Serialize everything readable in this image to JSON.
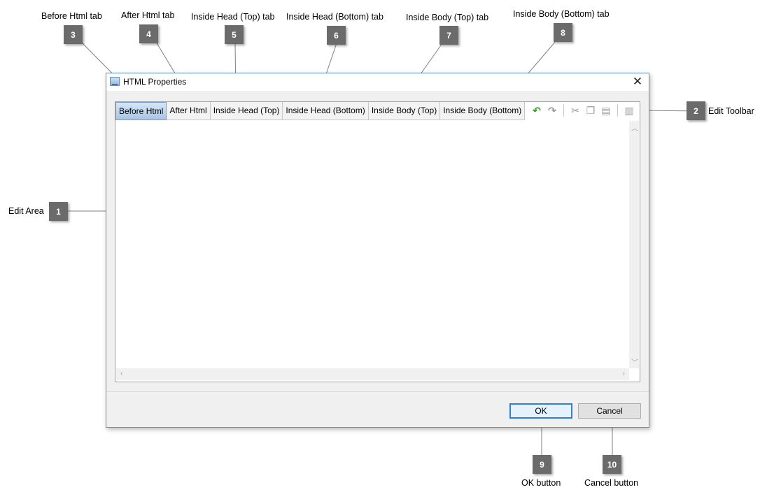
{
  "window": {
    "title": "HTML Properties"
  },
  "tabs": [
    {
      "label": "Before Html",
      "active": true
    },
    {
      "label": "After Html"
    },
    {
      "label": "Inside Head (Top)"
    },
    {
      "label": "Inside Head (Bottom)"
    },
    {
      "label": "Inside Body (Top)"
    },
    {
      "label": "Inside Body (Bottom)"
    }
  ],
  "toolbar": {
    "icons": [
      "undo-icon",
      "redo-icon",
      "cut-icon",
      "copy-icon",
      "paste-icon",
      "clear-icon"
    ]
  },
  "buttons": {
    "ok": "OK",
    "cancel": "Cancel"
  },
  "callouts": [
    {
      "number": "1",
      "label": "Edit Area"
    },
    {
      "number": "2",
      "label": "Edit Toolbar"
    },
    {
      "number": "3",
      "label": "Before Html tab"
    },
    {
      "number": "4",
      "label": "After Html tab"
    },
    {
      "number": "5",
      "label": "Inside Head (Top) tab"
    },
    {
      "number": "6",
      "label": "Inside Head (Bottom) tab"
    },
    {
      "number": "7",
      "label": "Inside Body (Top) tab"
    },
    {
      "number": "8",
      "label": "Inside Body (Bottom) tab"
    },
    {
      "number": "9",
      "label": "OK button"
    },
    {
      "number": "10",
      "label": "Cancel button"
    }
  ],
  "colors": {
    "accent": "#2f7fd3",
    "badge": "#6b6b6b",
    "undo": "#3f9a2c"
  }
}
